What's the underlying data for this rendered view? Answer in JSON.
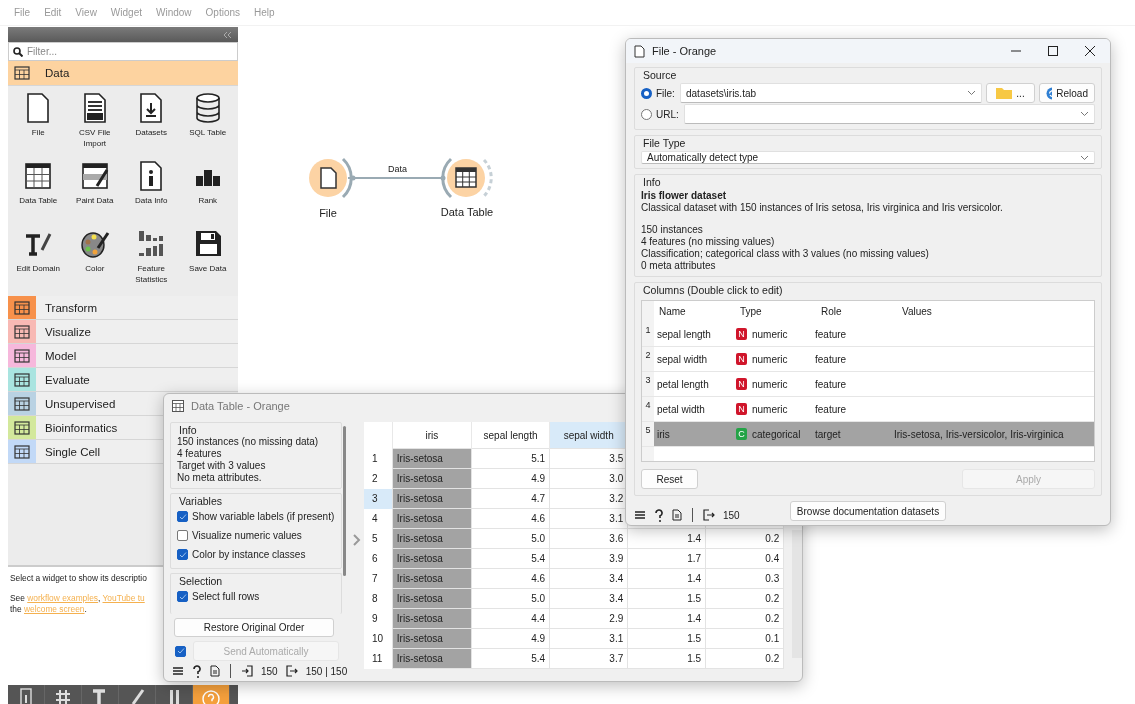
{
  "menu": [
    "File",
    "Edit",
    "View",
    "Widget",
    "Window",
    "Options",
    "Help"
  ],
  "toolbox": {
    "filter_placeholder": "Filter...",
    "categories": [
      {
        "name": "Data",
        "expanded": true,
        "color": "#fdd3a0",
        "widgets": [
          {
            "label": "File"
          },
          {
            "label": "CSV File Import"
          },
          {
            "label": "Datasets"
          },
          {
            "label": "SQL Table"
          },
          {
            "label": "Data Table"
          },
          {
            "label": "Paint Data"
          },
          {
            "label": "Data Info"
          },
          {
            "label": "Rank"
          },
          {
            "label": "Edit Domain"
          },
          {
            "label": "Color"
          },
          {
            "label": "Feature Statistics"
          },
          {
            "label": "Save Data"
          }
        ]
      },
      {
        "name": "Transform",
        "expanded": false,
        "color": "#f7914b"
      },
      {
        "name": "Visualize",
        "expanded": false,
        "color": "#f8b9b4"
      },
      {
        "name": "Model",
        "expanded": false,
        "color": "#f6b8dc"
      },
      {
        "name": "Evaluate",
        "expanded": false,
        "color": "#a9e4e0"
      },
      {
        "name": "Unsupervised",
        "expanded": false,
        "color": "#b9d2e3"
      },
      {
        "name": "Bioinformatics",
        "expanded": false,
        "color": "#d3e89c"
      },
      {
        "name": "Single Cell",
        "expanded": false,
        "color": "#c2d9f7"
      }
    ]
  },
  "description": {
    "first_line": "Select a widget to show its descriptio",
    "lines": [
      [
        {
          "kind": "text",
          "text": "See "
        },
        {
          "kind": "link",
          "text": "workflow examples"
        },
        {
          "kind": "text",
          "text": ", "
        },
        {
          "kind": "link",
          "text": "YouTube tu"
        }
      ],
      [
        {
          "kind": "text",
          "text": "the "
        },
        {
          "kind": "link",
          "text": "welcome screen"
        },
        {
          "kind": "text",
          "text": "."
        }
      ]
    ]
  },
  "canvas": {
    "nodes": [
      {
        "label": "File"
      },
      {
        "label": "Data Table"
      }
    ],
    "link": {
      "label": "Data"
    }
  },
  "data_table_window": {
    "title": "Data Table - Orange",
    "info": {
      "title": "Info",
      "lines": [
        "150 instances (no missing data)",
        "4 features",
        "Target with 3 values",
        "No meta attributes."
      ]
    },
    "variables": {
      "title": "Variables",
      "options": [
        {
          "label": "Show variable labels (if present)",
          "checked": true
        },
        {
          "label": "Visualize numeric values",
          "checked": false
        },
        {
          "label": "Color by instance classes",
          "checked": true
        }
      ]
    },
    "selection": {
      "title": "Selection",
      "options": [
        {
          "label": "Select full rows",
          "checked": true
        }
      ]
    },
    "restore_button": "Restore Original Order",
    "auto_send": {
      "label": "Send Automatically",
      "checked": true,
      "disabled": true
    },
    "status": {
      "input": "150",
      "output": "150 | 150"
    },
    "table": {
      "columns": [
        {
          "label": "iris",
          "selected": false
        },
        {
          "label": "sepal length",
          "selected": false
        },
        {
          "label": "sepal width",
          "selected": true
        }
      ],
      "rows": [
        {
          "number": "1",
          "selected": false,
          "cells": [
            "Iris-setosa",
            "5.1",
            "3.5"
          ]
        },
        {
          "number": "2",
          "selected": false,
          "cells": [
            "Iris-setosa",
            "4.9",
            "3.0"
          ]
        },
        {
          "number": "3",
          "selected": true,
          "cells": [
            "Iris-setosa",
            "4.7",
            "3.2"
          ]
        },
        {
          "number": "4",
          "selected": false,
          "cells": [
            "Iris-setosa",
            "4.6",
            "3.1"
          ]
        },
        {
          "number": "5",
          "selected": false,
          "cells": [
            "Iris-setosa",
            "5.0",
            "3.6",
            "1.4",
            "0.2"
          ]
        },
        {
          "number": "6",
          "selected": false,
          "cells": [
            "Iris-setosa",
            "5.4",
            "3.9",
            "1.7",
            "0.4"
          ]
        },
        {
          "number": "7",
          "selected": false,
          "cells": [
            "Iris-setosa",
            "4.6",
            "3.4",
            "1.4",
            "0.3"
          ]
        },
        {
          "number": "8",
          "selected": false,
          "cells": [
            "Iris-setosa",
            "5.0",
            "3.4",
            "1.5",
            "0.2"
          ]
        },
        {
          "number": "9",
          "selected": false,
          "cells": [
            "Iris-setosa",
            "4.4",
            "2.9",
            "1.4",
            "0.2"
          ]
        },
        {
          "number": "10",
          "selected": false,
          "cells": [
            "Iris-setosa",
            "4.9",
            "3.1",
            "1.5",
            "0.1"
          ]
        },
        {
          "number": "11",
          "selected": false,
          "cells": [
            "Iris-setosa",
            "5.4",
            "3.7",
            "1.5",
            "0.2"
          ]
        }
      ]
    }
  },
  "file_window": {
    "title": "File - Orange",
    "source": {
      "title": "Source",
      "options": [
        {
          "label": "File:",
          "selected": true,
          "value": "datasets\\iris.tab"
        },
        {
          "label": "URL:",
          "selected": false
        }
      ],
      "browse_button": "...",
      "reload_button": "Reload"
    },
    "file_type": {
      "title": "File Type",
      "value": "Automatically detect type"
    },
    "info": {
      "title": "Info",
      "heading": "Iris flower dataset",
      "description": "Classical dataset with 150 instances of Iris setosa, Iris virginica and Iris versicolor.",
      "lines": [
        "150 instances",
        "4 features (no missing values)",
        "Classification; categorical class with 3 values (no missing values)",
        "0 meta attributes"
      ]
    },
    "columns": {
      "title": "Columns (Double click to edit)",
      "headers": [
        "Name",
        "Type",
        "Role",
        "Values"
      ],
      "rows": [
        {
          "number": "1",
          "name": "sepal length",
          "badge": "N",
          "color": "#d0152b",
          "type": "numeric",
          "role": "feature",
          "selected": false
        },
        {
          "number": "2",
          "name": "sepal width",
          "badge": "N",
          "color": "#d0152b",
          "type": "numeric",
          "role": "feature",
          "selected": false
        },
        {
          "number": "3",
          "name": "petal length",
          "badge": "N",
          "color": "#d0152b",
          "type": "numeric",
          "role": "feature",
          "selected": false
        },
        {
          "number": "4",
          "name": "petal width",
          "badge": "N",
          "color": "#d0152b",
          "type": "numeric",
          "role": "feature",
          "selected": false
        },
        {
          "number": "5",
          "name": "iris",
          "badge": "C",
          "color": "#24a347",
          "type": "categorical",
          "role": "target",
          "values": "Iris-setosa, Iris-versicolor, Iris-virginica",
          "selected": true
        }
      ]
    },
    "reset_button": "Reset",
    "apply_button": {
      "label": "Apply",
      "disabled": true
    },
    "browse_docs_button": "Browse documentation datasets",
    "status": {
      "output": "150"
    }
  }
}
